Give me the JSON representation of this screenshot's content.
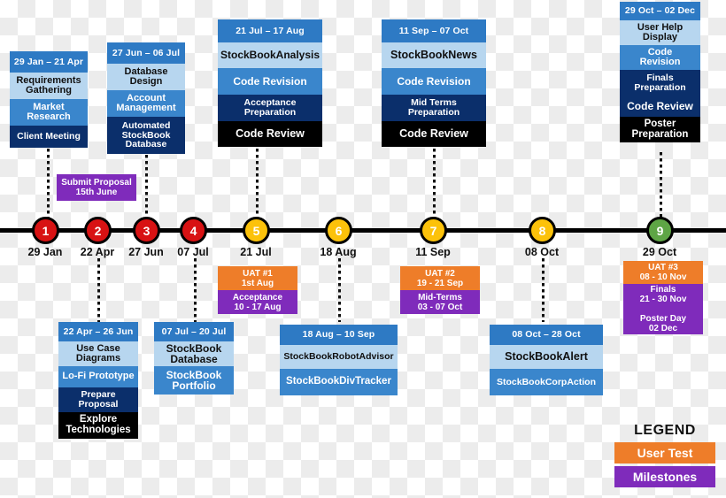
{
  "colors": {
    "header_blue": "#2e7ac4",
    "light_blue": "#b7d6ef",
    "mid_blue": "#3a86cc",
    "dark_blue": "#0b2f6b",
    "black": "#000000",
    "orange": "#ee7d29",
    "purple": "#7f2bbb",
    "red_node": "#d81213",
    "yellow_node": "#fcc20a",
    "green_node": "#5ea545"
  },
  "timeline": {
    "nodes": [
      {
        "number": "1",
        "date": "29 Jan",
        "color": "red"
      },
      {
        "number": "2",
        "date": "22 Apr",
        "color": "red"
      },
      {
        "number": "3",
        "date": "27 Jun",
        "color": "red"
      },
      {
        "number": "4",
        "date": "07 Jul",
        "color": "red"
      },
      {
        "number": "5",
        "date": "21 Jul",
        "color": "yellow"
      },
      {
        "number": "6",
        "date": "18 Aug",
        "color": "yellow"
      },
      {
        "number": "7",
        "date": "11 Sep",
        "color": "yellow"
      },
      {
        "number": "8",
        "date": "08 Oct",
        "color": "yellow"
      },
      {
        "number": "9",
        "date": "29 Oct",
        "color": "green"
      }
    ]
  },
  "phases_above": [
    {
      "id": "phase-1",
      "date_range": "29 Jan – 21 Apr",
      "tasks": [
        {
          "label": "Requirements\nGathering",
          "style": "light"
        },
        {
          "label": "Market\nResearch",
          "style": "mid"
        },
        {
          "label": "Client Meeting",
          "style": "dark"
        }
      ]
    },
    {
      "id": "phase-3",
      "date_range": "27 Jun – 06 Jul",
      "tasks": [
        {
          "label": "Database\nDesign",
          "style": "light"
        },
        {
          "label": "Account\nManagement",
          "style": "mid"
        },
        {
          "label": "Automated\nStockBook\nDatabase",
          "style": "dark"
        }
      ]
    },
    {
      "id": "phase-5",
      "date_range": "21 Jul – 17 Aug",
      "tasks": [
        {
          "label": "StockBookAnalysis",
          "style": "light"
        },
        {
          "label": "Code Revision",
          "style": "mid"
        },
        {
          "label": "Acceptance\nPreparation",
          "style": "dark"
        },
        {
          "label": "Code Review",
          "style": "black"
        }
      ]
    },
    {
      "id": "phase-7",
      "date_range": "11 Sep – 07 Oct",
      "tasks": [
        {
          "label": "StockBookNews",
          "style": "light"
        },
        {
          "label": "Code Revision",
          "style": "mid"
        },
        {
          "label": "Mid Terms\nPreparation",
          "style": "dark"
        },
        {
          "label": "Code Review",
          "style": "black"
        }
      ]
    },
    {
      "id": "phase-9",
      "date_range": "29 Oct – 02 Dec",
      "tasks": [
        {
          "label": "User Help\nDisplay",
          "style": "light"
        },
        {
          "label": "Code\nRevision",
          "style": "mid"
        },
        {
          "label": "Finals\nPreparation",
          "style": "dark"
        },
        {
          "label": "Code Review",
          "style": "dark"
        },
        {
          "label": "Poster\nPreparation",
          "style": "black"
        }
      ]
    }
  ],
  "phases_below": [
    {
      "id": "phase-2",
      "date_range": "22 Apr – 26 Jun",
      "tasks": [
        {
          "label": "Use Case\nDiagrams",
          "style": "light"
        },
        {
          "label": "Lo-Fi Prototype",
          "style": "mid"
        },
        {
          "label": "Prepare\nProposal",
          "style": "dark"
        },
        {
          "label": "Explore\nTechnologies",
          "style": "black"
        }
      ]
    },
    {
      "id": "phase-4",
      "date_range": "07 Jul – 20 Jul",
      "tasks": [
        {
          "label": "StockBook\nDatabase",
          "style": "light"
        },
        {
          "label": "StockBook\nPortfolio",
          "style": "mid"
        }
      ]
    },
    {
      "id": "phase-6",
      "date_range": "18 Aug – 10 Sep",
      "tasks": [
        {
          "label": "StockBookRobotAdvisor",
          "style": "light"
        },
        {
          "label": "StockBookDivTracker",
          "style": "mid"
        }
      ]
    },
    {
      "id": "phase-8",
      "date_range": "08 Oct – 28 Oct",
      "tasks": [
        {
          "label": "StockBookAlert",
          "style": "light"
        },
        {
          "label": "StockBookCorpAction",
          "style": "mid"
        }
      ]
    }
  ],
  "milestone_above": {
    "label": "Submit Proposal\n15th June"
  },
  "milestone_groups": [
    {
      "id": "uat-1-group",
      "cells": [
        {
          "label": "UAT #1\n1st Aug",
          "style": "orange"
        },
        {
          "label": "Acceptance\n10 - 17 Aug",
          "style": "purple"
        }
      ]
    },
    {
      "id": "uat-2-group",
      "cells": [
        {
          "label": "UAT #2\n19 - 21 Sep",
          "style": "orange"
        },
        {
          "label": "Mid-Terms\n03 - 07 Oct",
          "style": "purple"
        }
      ]
    },
    {
      "id": "uat-3-group",
      "cells": [
        {
          "label": "UAT #3\n08 - 10 Nov",
          "style": "orange"
        },
        {
          "label": "Finals\n21 - 30 Nov\n\nPoster Day\n02 Dec",
          "style": "purple"
        }
      ]
    }
  ],
  "legend": {
    "title": "LEGEND",
    "items": [
      {
        "label": "User Test",
        "style": "orange"
      },
      {
        "label": "Milestones",
        "style": "purple"
      }
    ]
  }
}
